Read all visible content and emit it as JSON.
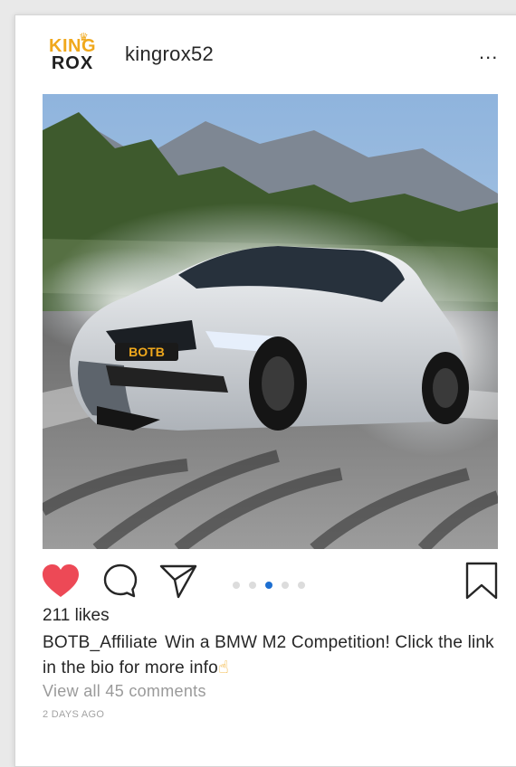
{
  "post": {
    "username": "kingrox52",
    "brand_logo": {
      "line1": "KING",
      "line2": "ROX"
    },
    "more_label": "...",
    "image_alt": "Silver BMW M2 Competition drifting with tyre smoke, BOTB plate",
    "plate_text": "BOTB",
    "carousel": {
      "count": 5,
      "active_index": 2
    },
    "likes": "211 likes",
    "caption": {
      "author": "BOTB_Affiliate",
      "text": "Win a BMW M2 Competition! Click the link in the bio for more info",
      "emoji": "☝"
    },
    "view_comments": "View all 45 comments",
    "timestamp": "2 DAYS AGO"
  },
  "icons": {
    "heart": "heart-icon",
    "comment": "comment-icon",
    "share": "share-icon",
    "bookmark": "bookmark-icon",
    "more": "more-icon"
  },
  "colors": {
    "like_active": "#ed4956",
    "carousel_active": "#1d6fd1",
    "brand_gold": "#f0a81c"
  }
}
